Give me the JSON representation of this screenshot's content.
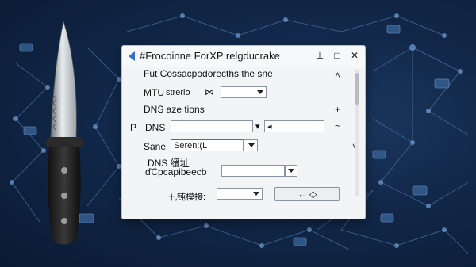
{
  "window": {
    "title": "#Frocoinne ForXP relgducrake"
  },
  "window_buttons": {
    "minimize": "⊥",
    "maximize": "□",
    "close": "✕"
  },
  "rows": {
    "header_text": "Fut Cossacpodorecths the sne",
    "mtu_label": "MTU",
    "mtu_value": "strerio",
    "mtu_glyph": "⋈",
    "dns_section": "DNS aze tions",
    "dns_label": "DNS",
    "dns_prefix": "P",
    "dns_input": "I",
    "dns_second_input": "◂",
    "sane_label": "Sane",
    "sane_value": "Seren:(L",
    "dns_cn_line1": "DNS 缓址",
    "dns_cn_line2": "ďCpcapibeecb",
    "bottom_label": "卂钝模接:",
    "bottom_button": "← ◇"
  },
  "side_glyphs": {
    "up1": "˄",
    "plus": "+",
    "tilde": "~",
    "down": "˅"
  }
}
